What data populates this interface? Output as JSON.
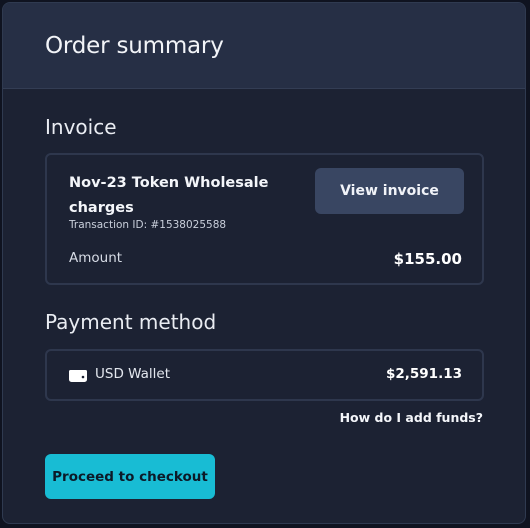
{
  "header": {
    "title": "Order summary"
  },
  "invoice": {
    "section_title": "Invoice",
    "name": "Nov-23 Token Wholesale charges",
    "transaction_id": "Transaction ID: #1538025588",
    "view_button_label": "View invoice",
    "amount_label": "Amount",
    "amount_value": "$155.00"
  },
  "payment": {
    "section_title": "Payment method",
    "wallet_icon": "wallet-icon",
    "wallet_label": "USD Wallet",
    "wallet_balance": "$2,591.13",
    "add_funds_link": "How do I add funds?"
  },
  "actions": {
    "checkout_label": "Proceed to checkout"
  },
  "colors": {
    "panel_bg": "#1c2233",
    "header_bg": "#262f45",
    "secondary_button": "#394662",
    "accent": "#18bcd4"
  }
}
